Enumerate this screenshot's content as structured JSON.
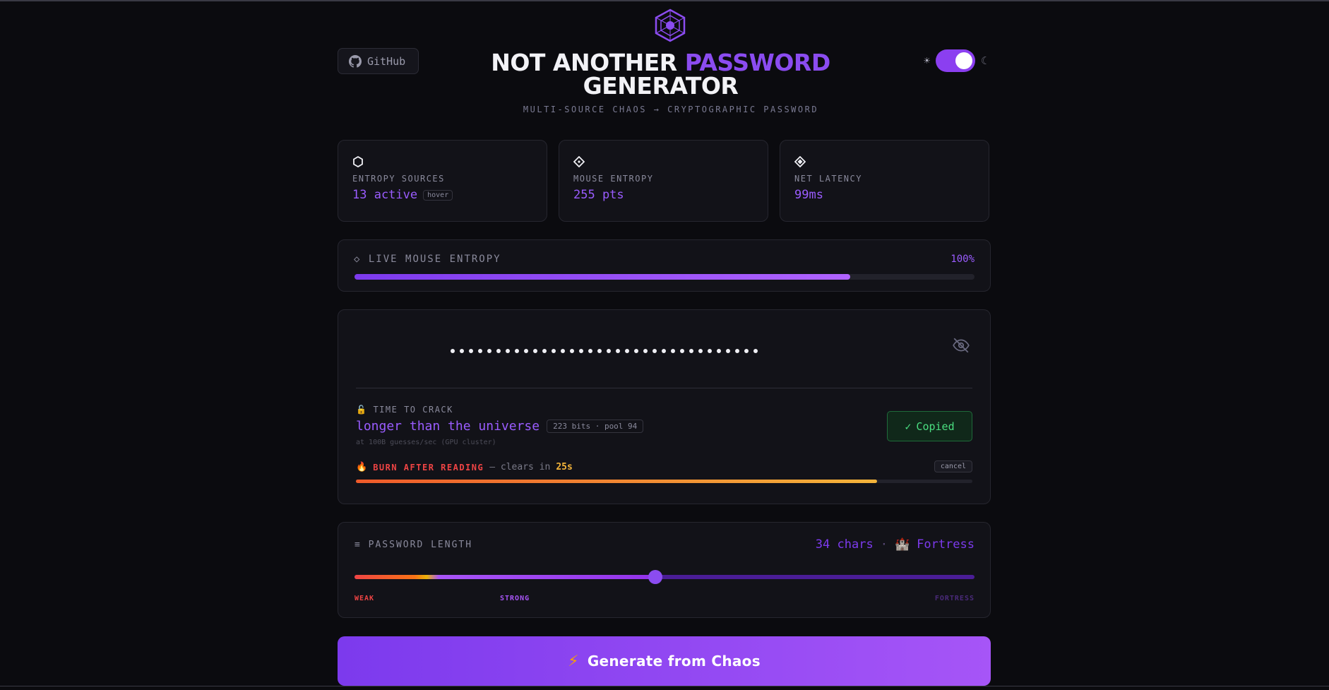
{
  "header": {
    "github_label": "GitHub",
    "title_part1": "NOT ANOTHER",
    "title_accent": "PASSWORD",
    "title_part2": "GENERATOR",
    "subtitle": "MULTI-SOURCE CHAOS → CRYPTOGRAPHIC PASSWORD",
    "theme_sun": "☀",
    "theme_moon": "☾",
    "dark_mode_on": true
  },
  "stats": [
    {
      "icon": "hexagon-icon",
      "label": "ENTROPY SOURCES",
      "value": "13 active",
      "badge": "hover"
    },
    {
      "icon": "diamond-outline-icon",
      "label": "MOUSE ENTROPY",
      "value": "255 pts"
    },
    {
      "icon": "diamond-filled-icon",
      "label": "NET LATENCY",
      "value": "99ms"
    }
  ],
  "live_entropy": {
    "icon": "◇",
    "label": "LIVE MOUSE ENTROPY",
    "percent_label": "100%",
    "bar_fill": 0.8
  },
  "password": {
    "masked_count": 34,
    "toggle_icon": "eye-off-icon",
    "time_to_crack_label": "TIME TO CRACK",
    "time_to_crack_value": "longer than the universe",
    "bits_badge": "223 bits · pool 94",
    "rate_note": "at 100B guesses/sec (GPU cluster)",
    "copy_check": "✓",
    "copy_label": "Copied",
    "burn_title": "BURN AFTER READING",
    "burn_text": "— clears in",
    "burn_seconds": "25s",
    "cancel_label": "cancel",
    "burn_progress": 0.845
  },
  "length": {
    "icon": "≡",
    "label": "PASSWORD LENGTH",
    "chars_label": "34 chars",
    "separator": "·",
    "tier_emoji": "🏰",
    "tier_label": "Fortress",
    "slider_fraction": 0.485,
    "scale": {
      "weak": "WEAK",
      "strong": "STRONG",
      "fortress": "FORTRESS"
    }
  },
  "generate": {
    "label": "Generate from Chaos"
  },
  "colors": {
    "accent": "#8b4cf0",
    "success": "#4ade80",
    "danger": "#ef4444",
    "warning": "#f4b43a"
  }
}
